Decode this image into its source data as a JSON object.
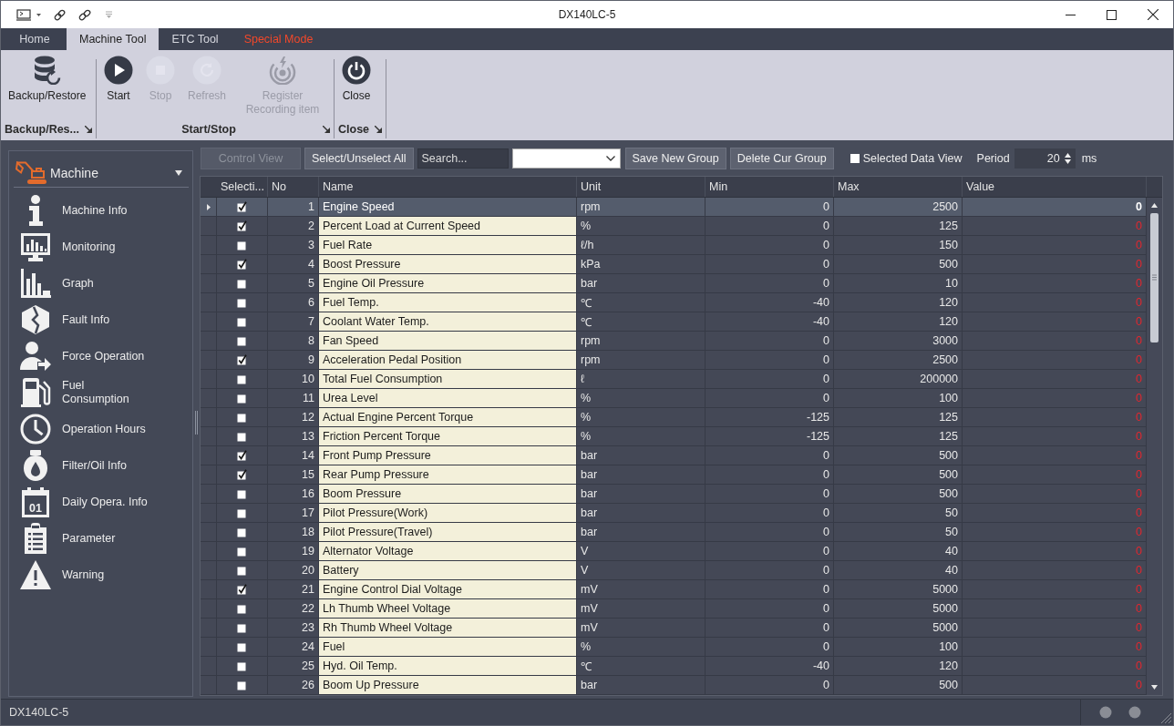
{
  "window": {
    "title": "DX140LC-5"
  },
  "ribbon_tabs": [
    {
      "label": "Home",
      "selected": false,
      "kind": "normal"
    },
    {
      "label": "Machine Tool",
      "selected": true,
      "kind": "normal"
    },
    {
      "label": "ETC Tool",
      "selected": false,
      "kind": "normal"
    },
    {
      "label": "Special Mode",
      "selected": false,
      "kind": "special"
    }
  ],
  "ribbon_groups": [
    {
      "label": "Backup/Res...",
      "buttons": [
        {
          "label": "Backup/Restore",
          "disabled": false
        }
      ]
    },
    {
      "label": "Start/Stop",
      "buttons": [
        {
          "label": "Start",
          "disabled": false
        },
        {
          "label": "Stop",
          "disabled": true
        },
        {
          "label": "Refresh",
          "disabled": true
        },
        {
          "label": "Register Recording item",
          "disabled": true
        }
      ]
    },
    {
      "label": "Close",
      "buttons": [
        {
          "label": "Close",
          "disabled": false
        }
      ]
    }
  ],
  "sidebar": {
    "category": "Machine",
    "items": [
      {
        "label": "Machine Info",
        "selected": false
      },
      {
        "label": "Monitoring",
        "selected": false
      },
      {
        "label": "Graph",
        "selected": false
      },
      {
        "label": "Fault Info",
        "selected": false
      },
      {
        "label": "Force Operation",
        "selected": false
      },
      {
        "label": "Fuel\nConsumption",
        "selected": false
      },
      {
        "label": "Operation Hours",
        "selected": false
      },
      {
        "label": "Filter/Oil Info",
        "selected": false
      },
      {
        "label": "Daily Opera. Info",
        "selected": false,
        "icon_text": "01"
      },
      {
        "label": "Parameter",
        "selected": false
      },
      {
        "label": "Warning",
        "selected": false
      }
    ]
  },
  "toolbar": {
    "buttons": [
      {
        "label": "Control View",
        "disabled": true
      },
      {
        "label": "Select/Unselect All",
        "disabled": false
      }
    ],
    "search": {
      "placeholder": "Search..."
    },
    "group_buttons": [
      {
        "label": "Save New Group",
        "disabled": false
      },
      {
        "label": "Delete Cur Group",
        "disabled": false
      }
    ],
    "selected_data_view": {
      "label": "Selected Data View",
      "checked": false
    },
    "period": {
      "label": "Period",
      "value": "20",
      "unit": "ms"
    }
  },
  "table": {
    "columns": [
      "Selecti...",
      "No",
      "Name",
      "Unit",
      "Min",
      "Max",
      "Value"
    ],
    "rows": [
      {
        "selected": true,
        "checked": true,
        "no": "1",
        "name": "Engine Speed",
        "unit": "rpm",
        "min": "0",
        "max": "2500",
        "value": "0"
      },
      {
        "selected": false,
        "checked": true,
        "no": "2",
        "name": "Percent Load at Current Speed",
        "unit": "%",
        "min": "0",
        "max": "125",
        "value": "0"
      },
      {
        "selected": false,
        "checked": false,
        "no": "3",
        "name": "Fuel Rate",
        "unit": "ℓ/h",
        "min": "0",
        "max": "150",
        "value": "0"
      },
      {
        "selected": false,
        "checked": true,
        "no": "4",
        "name": "Boost Pressure",
        "unit": "kPa",
        "min": "0",
        "max": "500",
        "value": "0"
      },
      {
        "selected": false,
        "checked": false,
        "no": "5",
        "name": "Engine Oil Pressure",
        "unit": "bar",
        "min": "0",
        "max": "10",
        "value": "0"
      },
      {
        "selected": false,
        "checked": false,
        "no": "6",
        "name": "Fuel Temp.",
        "unit": "℃",
        "min": "-40",
        "max": "120",
        "value": "0"
      },
      {
        "selected": false,
        "checked": false,
        "no": "7",
        "name": "Coolant Water Temp.",
        "unit": "℃",
        "min": "-40",
        "max": "120",
        "value": "0"
      },
      {
        "selected": false,
        "checked": false,
        "no": "8",
        "name": "Fan Speed",
        "unit": "rpm",
        "min": "0",
        "max": "3000",
        "value": "0"
      },
      {
        "selected": false,
        "checked": true,
        "no": "9",
        "name": "Acceleration Pedal Position",
        "unit": "rpm",
        "min": "0",
        "max": "2500",
        "value": "0"
      },
      {
        "selected": false,
        "checked": false,
        "no": "10",
        "name": "Total Fuel Consumption",
        "unit": "ℓ",
        "min": "0",
        "max": "200000",
        "value": "0"
      },
      {
        "selected": false,
        "checked": false,
        "no": "11",
        "name": "Urea Level",
        "unit": "%",
        "min": "0",
        "max": "100",
        "value": "0"
      },
      {
        "selected": false,
        "checked": false,
        "no": "12",
        "name": "Actual Engine Percent Torque",
        "unit": "%",
        "min": "-125",
        "max": "125",
        "value": "0"
      },
      {
        "selected": false,
        "checked": false,
        "no": "13",
        "name": "Friction Percent Torque",
        "unit": "%",
        "min": "-125",
        "max": "125",
        "value": "0"
      },
      {
        "selected": false,
        "checked": true,
        "no": "14",
        "name": "Front Pump Pressure",
        "unit": "bar",
        "min": "0",
        "max": "500",
        "value": "0"
      },
      {
        "selected": false,
        "checked": true,
        "no": "15",
        "name": "Rear Pump Pressure",
        "unit": "bar",
        "min": "0",
        "max": "500",
        "value": "0"
      },
      {
        "selected": false,
        "checked": false,
        "no": "16",
        "name": "Boom Pressure",
        "unit": "bar",
        "min": "0",
        "max": "500",
        "value": "0"
      },
      {
        "selected": false,
        "checked": false,
        "no": "17",
        "name": "Pilot Pressure(Work)",
        "unit": "bar",
        "min": "0",
        "max": "50",
        "value": "0"
      },
      {
        "selected": false,
        "checked": false,
        "no": "18",
        "name": "Pilot Pressure(Travel)",
        "unit": "bar",
        "min": "0",
        "max": "50",
        "value": "0"
      },
      {
        "selected": false,
        "checked": false,
        "no": "19",
        "name": "Alternator Voltage",
        "unit": "V",
        "min": "0",
        "max": "40",
        "value": "0"
      },
      {
        "selected": false,
        "checked": false,
        "no": "20",
        "name": "Battery",
        "unit": "V",
        "min": "0",
        "max": "40",
        "value": "0"
      },
      {
        "selected": false,
        "checked": true,
        "no": "21",
        "name": "Engine Control Dial Voltage",
        "unit": "mV",
        "min": "0",
        "max": "5000",
        "value": "0"
      },
      {
        "selected": false,
        "checked": false,
        "no": "22",
        "name": "Lh Thumb Wheel Voltage",
        "unit": "mV",
        "min": "0",
        "max": "5000",
        "value": "0"
      },
      {
        "selected": false,
        "checked": false,
        "no": "23",
        "name": "Rh Thumb Wheel Voltage",
        "unit": "mV",
        "min": "0",
        "max": "5000",
        "value": "0"
      },
      {
        "selected": false,
        "checked": false,
        "no": "24",
        "name": "Fuel",
        "unit": "%",
        "min": "0",
        "max": "100",
        "value": "0"
      },
      {
        "selected": false,
        "checked": false,
        "no": "25",
        "name": "Hyd. Oil Temp.",
        "unit": "℃",
        "min": "-40",
        "max": "120",
        "value": "0"
      },
      {
        "selected": false,
        "checked": false,
        "no": "26",
        "name": "Boom Up Pressure",
        "unit": "bar",
        "min": "0",
        "max": "500",
        "value": "0"
      }
    ]
  },
  "status_bar": {
    "text": "DX140LC-5"
  }
}
